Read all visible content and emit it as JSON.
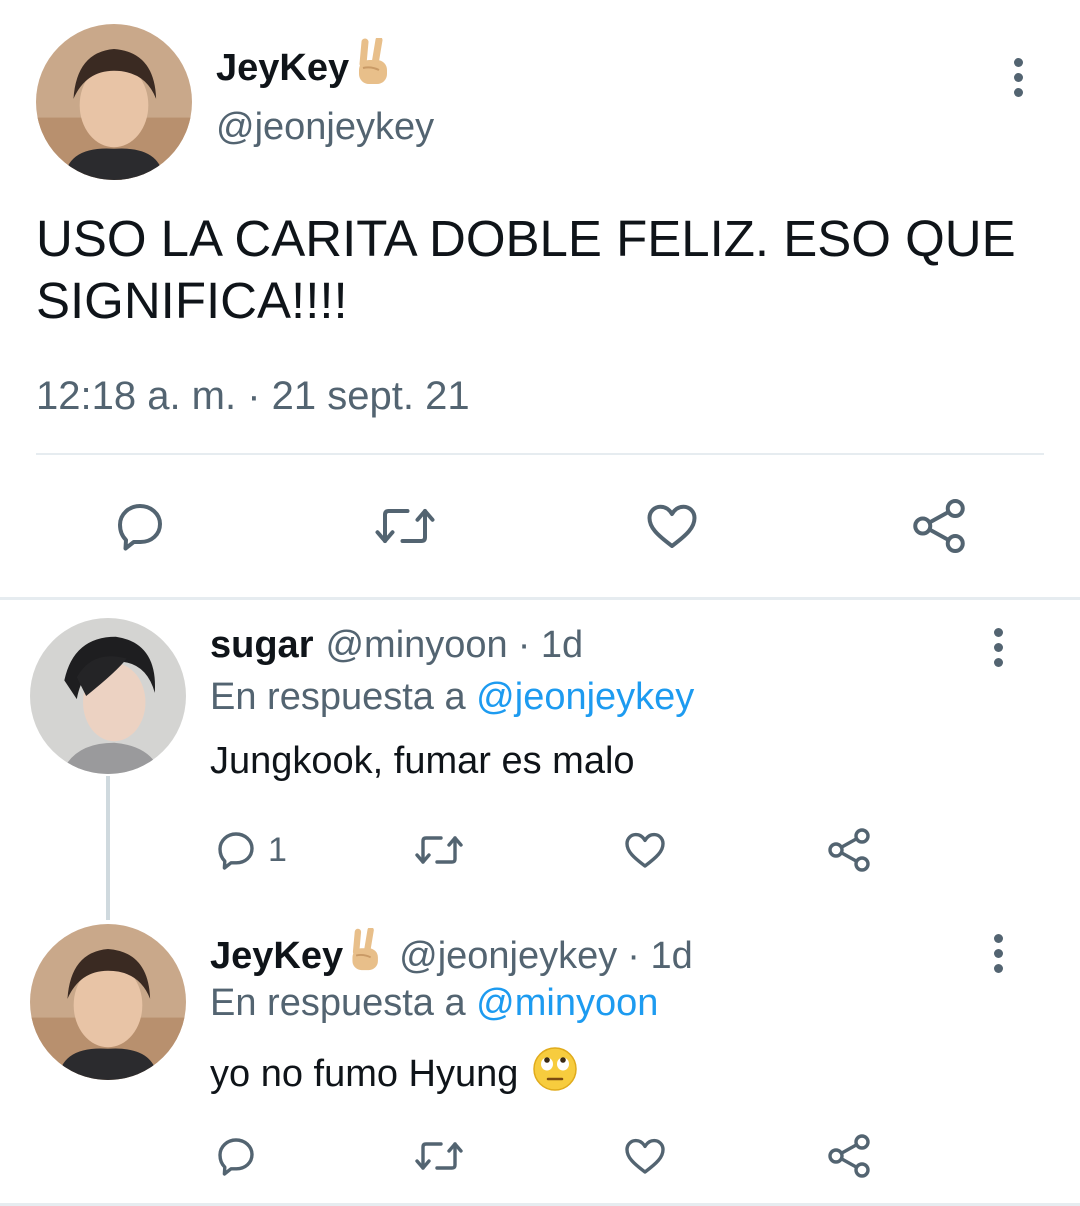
{
  "main_tweet": {
    "display_name": "JeyKey",
    "name_emoji": "victory-hand-emoji",
    "handle": "@jeonjeykey",
    "text": "USO LA CARITA DOBLE FELIZ. ESO QUE SIGNIFICA!!!!",
    "timestamp": "12:18 a. m. · 21 sept. 21",
    "icons": [
      "reply-icon",
      "retweet-icon",
      "like-icon",
      "share-icon",
      "more-icon"
    ]
  },
  "replies": [
    {
      "display_name": "sugar",
      "handle": "@minyoon",
      "age": "· 1d",
      "reply_prefix": "En respuesta a",
      "reply_to": "@jeonjeykey",
      "text": "Jungkook, fumar es malo",
      "reply_count": "1"
    },
    {
      "display_name": "JeyKey",
      "name_emoji": "victory-hand-emoji",
      "handle": "@jeonjeykey",
      "age": "· 1d",
      "reply_prefix": "En respuesta a",
      "reply_to": "@minyoon",
      "text": "yo no fumo Hyung",
      "text_emoji": "face-with-rolling-eyes-emoji",
      "reply_count": ""
    }
  ],
  "colors": {
    "text": "#0f1419",
    "secondary": "#536471",
    "link": "#1d9bf0",
    "divider": "#e6ecf0"
  }
}
